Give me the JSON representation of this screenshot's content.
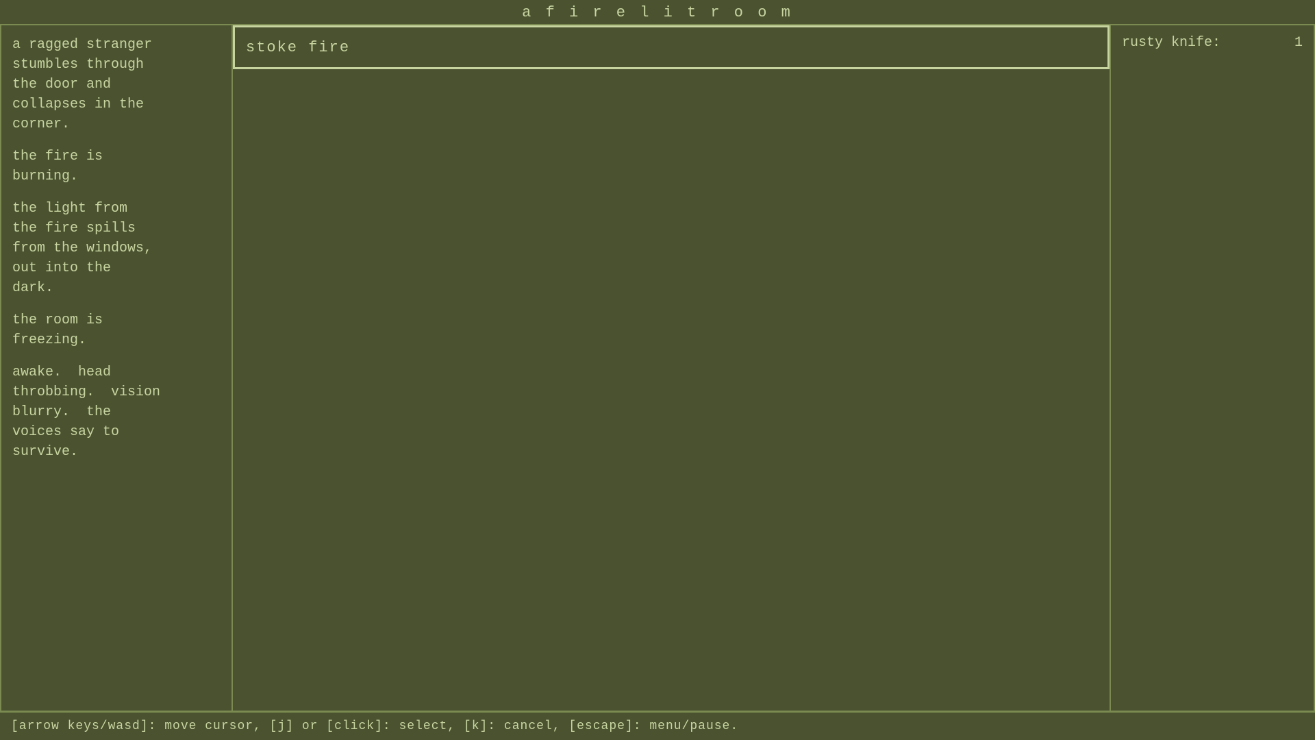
{
  "title": "a  f i r e l i t   r o o m",
  "left_panel": {
    "paragraphs": [
      "a ragged stranger\nstumbles through\nthe door and\ncollapses in the\ncorner.",
      "the fire is\nburning.",
      "the light from\nthe fire spills\nfrom the windows,\nout into the\ndark.",
      "the room is\nfreezing.",
      "awake.  head\nthrobbing.  vision\nblurry.  the\nvoices say to\nsurvive."
    ]
  },
  "center_panel": {
    "action_text": "stoke fire"
  },
  "right_panel": {
    "inventory": [
      {
        "name": "rusty knife:",
        "count": "1"
      }
    ]
  },
  "status_bar": {
    "text": "[arrow keys/wasd]:  move cursor,  [j] or [click]:  select,  [k]:  cancel,  [escape]:  menu/pause."
  }
}
